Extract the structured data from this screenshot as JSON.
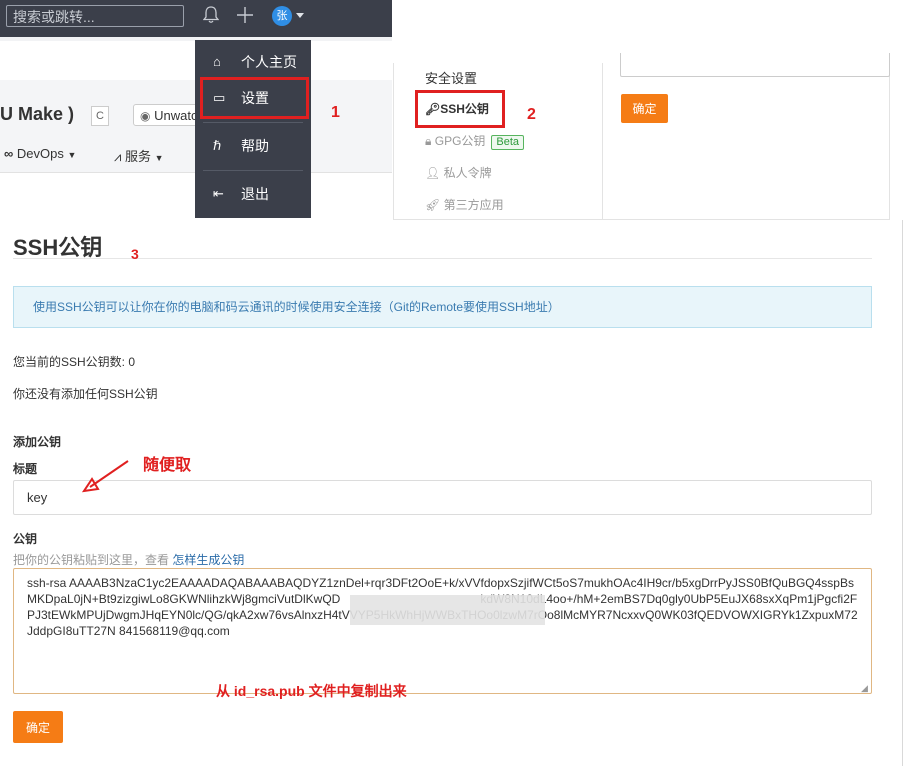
{
  "navbar": {
    "search_placeholder": "搜索或跳转...",
    "avatar_text": "张"
  },
  "project": {
    "title": "U Make )",
    "badge": "C",
    "unwatch_label": "Unwatch",
    "devops_label": "DevOps",
    "service_label": "服务"
  },
  "user_menu": {
    "items": [
      {
        "label": "个人主页",
        "icon": "home-icon"
      },
      {
        "label": "设置",
        "icon": "settings-icon"
      },
      {
        "label": "帮助",
        "icon": "help-icon"
      },
      {
        "label": "退出",
        "icon": "logout-icon"
      }
    ]
  },
  "settings_sidebar": {
    "section_title": "安全设置",
    "items": [
      {
        "label": "SSH公钥",
        "icon": "key-icon",
        "active": true
      },
      {
        "label": "GPG公钥",
        "icon": "lock-icon",
        "badge": "Beta"
      },
      {
        "label": "私人令牌",
        "icon": "person-icon"
      },
      {
        "label": "第三方应用",
        "icon": "rocket-icon"
      }
    ],
    "confirm_label": "确定"
  },
  "ssh_page": {
    "title": "SSH公钥",
    "info_text": "使用SSH公钥可以让你在你的电脑和码云通讯的时候使用安全连接（Git的Remote要使用SSH地址）",
    "key_count_text": "您当前的SSH公钥数: 0",
    "no_key_text": "你还没有添加任何SSH公钥",
    "add_key_heading": "添加公钥",
    "title_label": "标题",
    "title_value": "key",
    "key_label": "公钥",
    "hint_text": "把你的公钥粘贴到这里，查看 ",
    "hint_link": "怎样生成公钥",
    "key_value": "ssh-rsa AAAAB3NzaC1yc2EAAAADAQABAAABAQDYZ1znDel+rqr3DFt2OoE+k/xVVfdopxSzjifWCt5oS7mukhOAc4IH9cr/b5xgDrrPyJSS0BfQuBGQ4sspBsMKDpaL0jN+Bt9zizgiwLo8GKWNlihzkWj8gmciVutDlKwQD                                          kdW8N10dL4oo+/hM+2emBS7Dq0gly0UbP5EuJX68sxXqPm1jPgcfi2FPJ3tEWkMPUjDwgmJHqEYN0lc/QG/qkA2xw76vsAlnxzH4tVVYP5HkWhHjWWBxTHOo0lzwM7rOo8lMcMYR7NcxxvQ0WK03fQEDVOWXIGRYk1ZxpuxM72JddpGI8uTT27N 841568119@qq.com",
    "submit_label": "确定"
  },
  "annotations": {
    "step1": "1",
    "step2": "2",
    "step3": "3",
    "note_title": "随便取",
    "note_key": "从  id_rsa.pub 文件中复制出来"
  },
  "colors": {
    "accent_orange": "#f57c15",
    "navbar_dark": "#3b3f4a",
    "annotation_red": "#e02020",
    "info_blue": "#3a7bb0"
  }
}
